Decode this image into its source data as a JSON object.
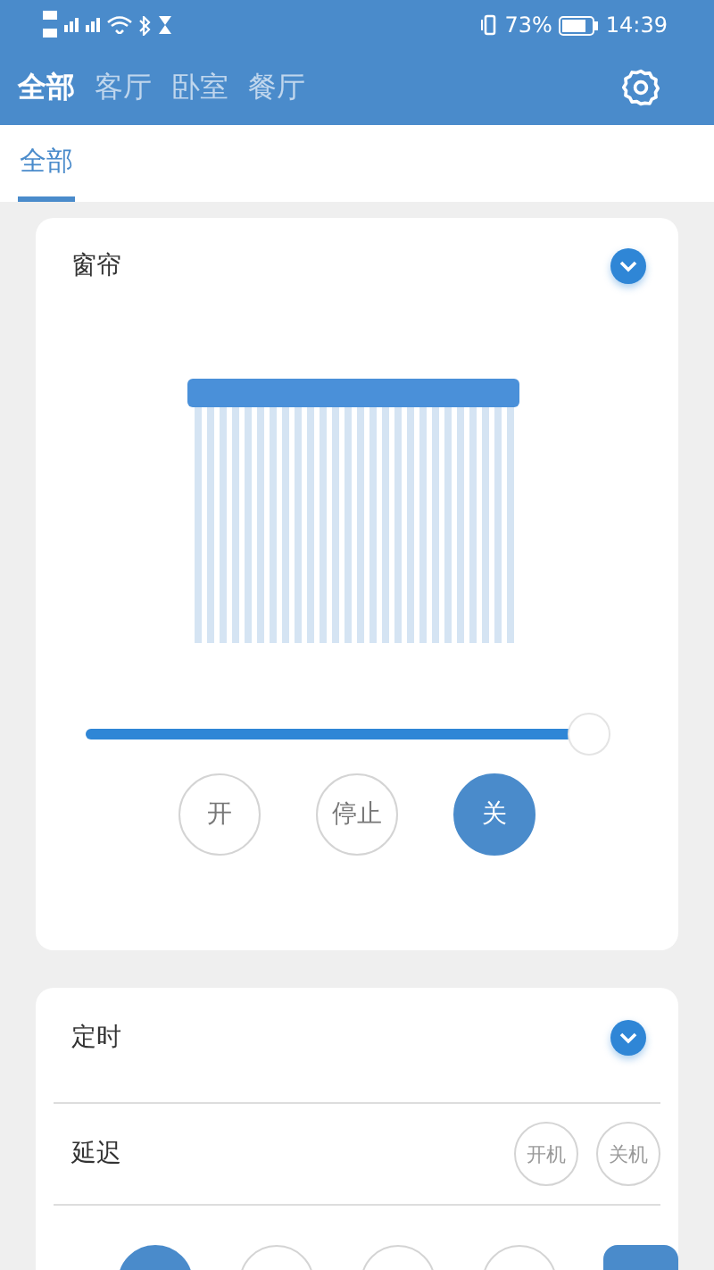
{
  "status_bar": {
    "battery_text": "73%",
    "time": "14:39"
  },
  "room_tabs": [
    {
      "label": "全部",
      "selected": true
    },
    {
      "label": "客厅",
      "selected": false
    },
    {
      "label": "卧室",
      "selected": false
    },
    {
      "label": "餐厅",
      "selected": false
    }
  ],
  "sub_tabs": [
    {
      "label": "全部",
      "selected": true
    }
  ],
  "curtain_card": {
    "title": "窗帘",
    "expanded": true,
    "slider": {
      "level": 0.96
    },
    "buttons": [
      {
        "label": "开",
        "selected": false
      },
      {
        "label": "停止",
        "selected": false
      },
      {
        "label": "关",
        "selected": true
      }
    ]
  },
  "timer_card": {
    "title": "定时",
    "expanded": true,
    "delay_label": "延迟",
    "delay_buttons": [
      {
        "label": "开机",
        "selected": false
      },
      {
        "label": "关机",
        "selected": false
      }
    ],
    "bottom_buttons": [
      {
        "kind": "circle",
        "selected": true
      },
      {
        "kind": "circle",
        "selected": false
      },
      {
        "kind": "circle",
        "selected": false
      },
      {
        "kind": "circle",
        "selected": false
      },
      {
        "kind": "pill",
        "selected": true
      }
    ]
  }
}
